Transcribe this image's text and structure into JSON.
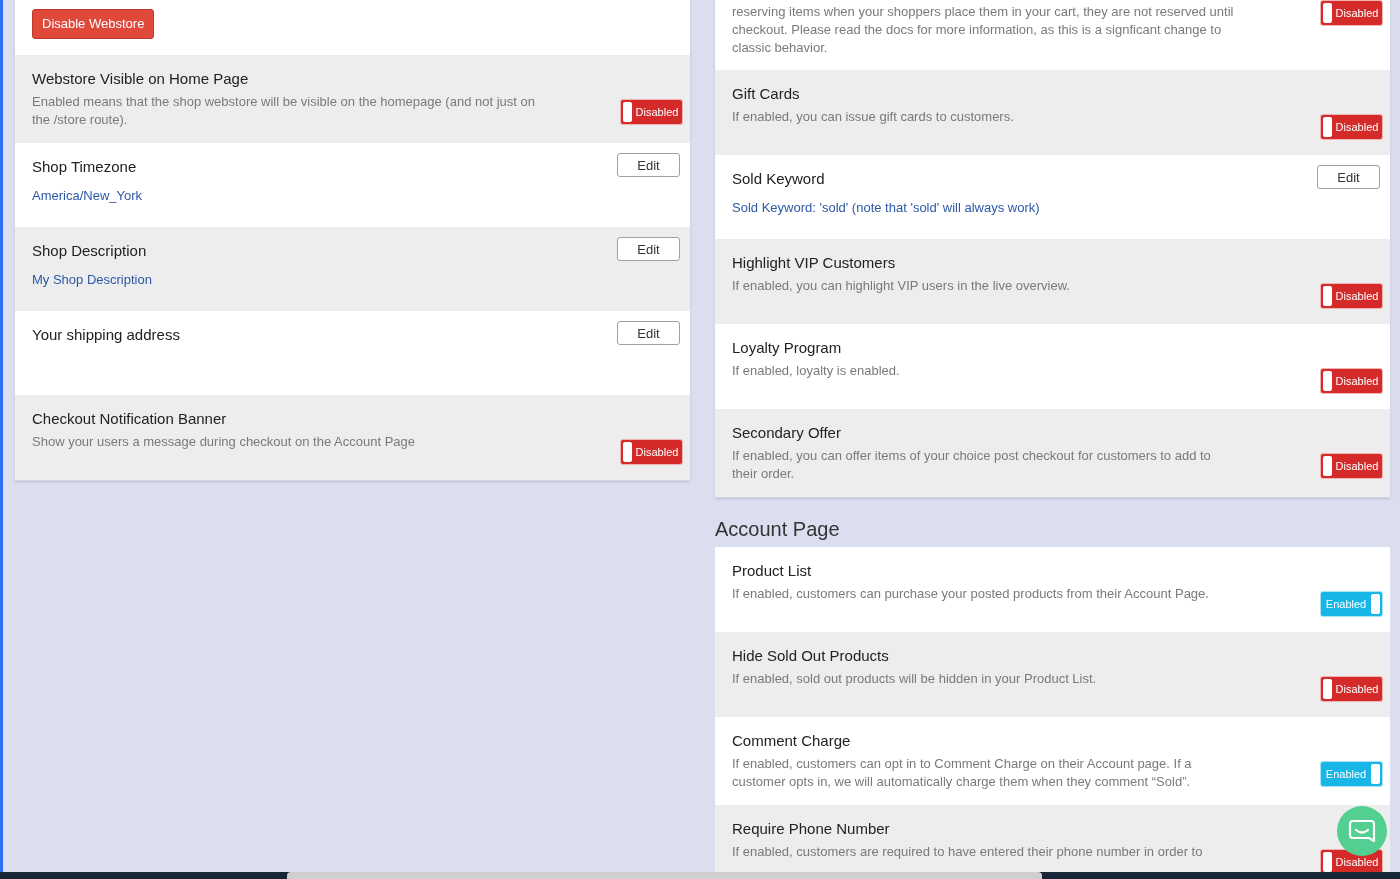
{
  "left_panel": {
    "rows": [
      {
        "kind": "action",
        "button": "Disable Webstore"
      },
      {
        "kind": "toggle",
        "title": "Webstore Visible on Home Page",
        "description": "Enabled means that the shop webstore will be visible on the homepage (and not just on\nthe /store route).",
        "toggle": {
          "label": "Disabled",
          "enabled": false
        }
      },
      {
        "kind": "edit",
        "title": "Shop Timezone",
        "value": "America/New_York",
        "edit": "Edit"
      },
      {
        "kind": "edit",
        "title": "Shop Description",
        "value": "My Shop Description",
        "edit": "Edit"
      },
      {
        "kind": "edit",
        "title": "Your shipping address",
        "edit": "Edit"
      },
      {
        "kind": "toggle",
        "title": "Checkout Notification Banner",
        "description": "Show your users a message during checkout on the Account Page",
        "toggle": {
          "label": "Disabled",
          "enabled": false
        }
      }
    ]
  },
  "right_panel": {
    "rows": [
      {
        "kind": "toggle",
        "description": "reserving items when your shoppers place them in your cart, they are not reserved until\ncheckout. Please read the docs for more information, as this is a signficant change to\nclassic behavior.",
        "toggle": {
          "label": "Disabled",
          "enabled": false
        }
      },
      {
        "kind": "toggle",
        "title": "Gift Cards",
        "description": "If enabled, you can issue gift cards to customers.",
        "toggle": {
          "label": "Disabled",
          "enabled": false
        }
      },
      {
        "kind": "edit",
        "title": "Sold Keyword",
        "value": "Sold Keyword: 'sold' (note that 'sold' will always work)",
        "edit": "Edit"
      },
      {
        "kind": "toggle",
        "title": "Highlight VIP Customers",
        "description": "If enabled, you can highlight VIP users in the live overview.",
        "toggle": {
          "label": "Disabled",
          "enabled": false
        }
      },
      {
        "kind": "toggle",
        "title": "Loyalty Program",
        "description": "If enabled, loyalty is enabled.",
        "toggle": {
          "label": "Disabled",
          "enabled": false
        }
      },
      {
        "kind": "toggle",
        "title": "Secondary Offer",
        "description": "If enabled, you can offer items of your choice post checkout for customers to add to\ntheir order.",
        "toggle": {
          "label": "Disabled",
          "enabled": false
        }
      }
    ]
  },
  "account_page": {
    "heading": "Account Page",
    "rows": [
      {
        "kind": "toggle",
        "title": "Product List",
        "description": "If enabled, customers can purchase your posted products from their Account Page.",
        "toggle": {
          "label": "Enabled",
          "enabled": true
        }
      },
      {
        "kind": "toggle",
        "title": "Hide Sold Out Products",
        "description": "If enabled, sold out products will be hidden in your Product List.",
        "toggle": {
          "label": "Disabled",
          "enabled": false
        }
      },
      {
        "kind": "toggle",
        "title": "Comment Charge",
        "description": "If enabled, customers can opt in to Comment Charge on their Account page. If a\ncustomer opts in, we will automatically charge them when they comment “Sold”.",
        "toggle": {
          "label": "Enabled",
          "enabled": true
        }
      },
      {
        "kind": "toggle",
        "title": "Require Phone Number",
        "description": "If enabled, customers are required to have entered their phone number in order to",
        "toggle": {
          "label": "Disabled",
          "enabled": false
        }
      }
    ]
  }
}
